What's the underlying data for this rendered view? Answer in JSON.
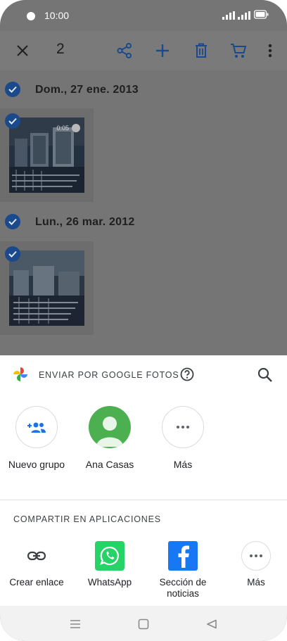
{
  "status_bar": {
    "time": "10:00"
  },
  "toolbar": {
    "selected_count": "2"
  },
  "gallery": {
    "groups": [
      {
        "date": "Dom., 27 ene. 2013",
        "video_duration": "0:05"
      },
      {
        "date": "Lun., 26 mar. 2012"
      }
    ]
  },
  "share_sheet": {
    "title": "ENVIAR POR GOOGLE FOTOS",
    "people": [
      {
        "label": "Nuevo grupo",
        "icon": "group-add-icon"
      },
      {
        "label": "Ana Casas",
        "icon": "avatar-icon",
        "color": "#4caf50"
      },
      {
        "label": "Más",
        "icon": "more-horiz-icon"
      }
    ],
    "apps_section_title": "COMPARTIR EN APLICACIONES",
    "apps": [
      {
        "label": "Crear enlace",
        "icon": "link-icon"
      },
      {
        "label": "WhatsApp",
        "icon": "whatsapp-icon",
        "color": "#25d366"
      },
      {
        "label": "Sección de noticias",
        "icon": "facebook-icon",
        "color": "#1877f2"
      },
      {
        "label": "Más",
        "icon": "more-horiz-icon"
      }
    ]
  },
  "colors": {
    "accent": "#1a73e8",
    "selection_check": "#1a4a8c",
    "scrim": "#757575"
  }
}
